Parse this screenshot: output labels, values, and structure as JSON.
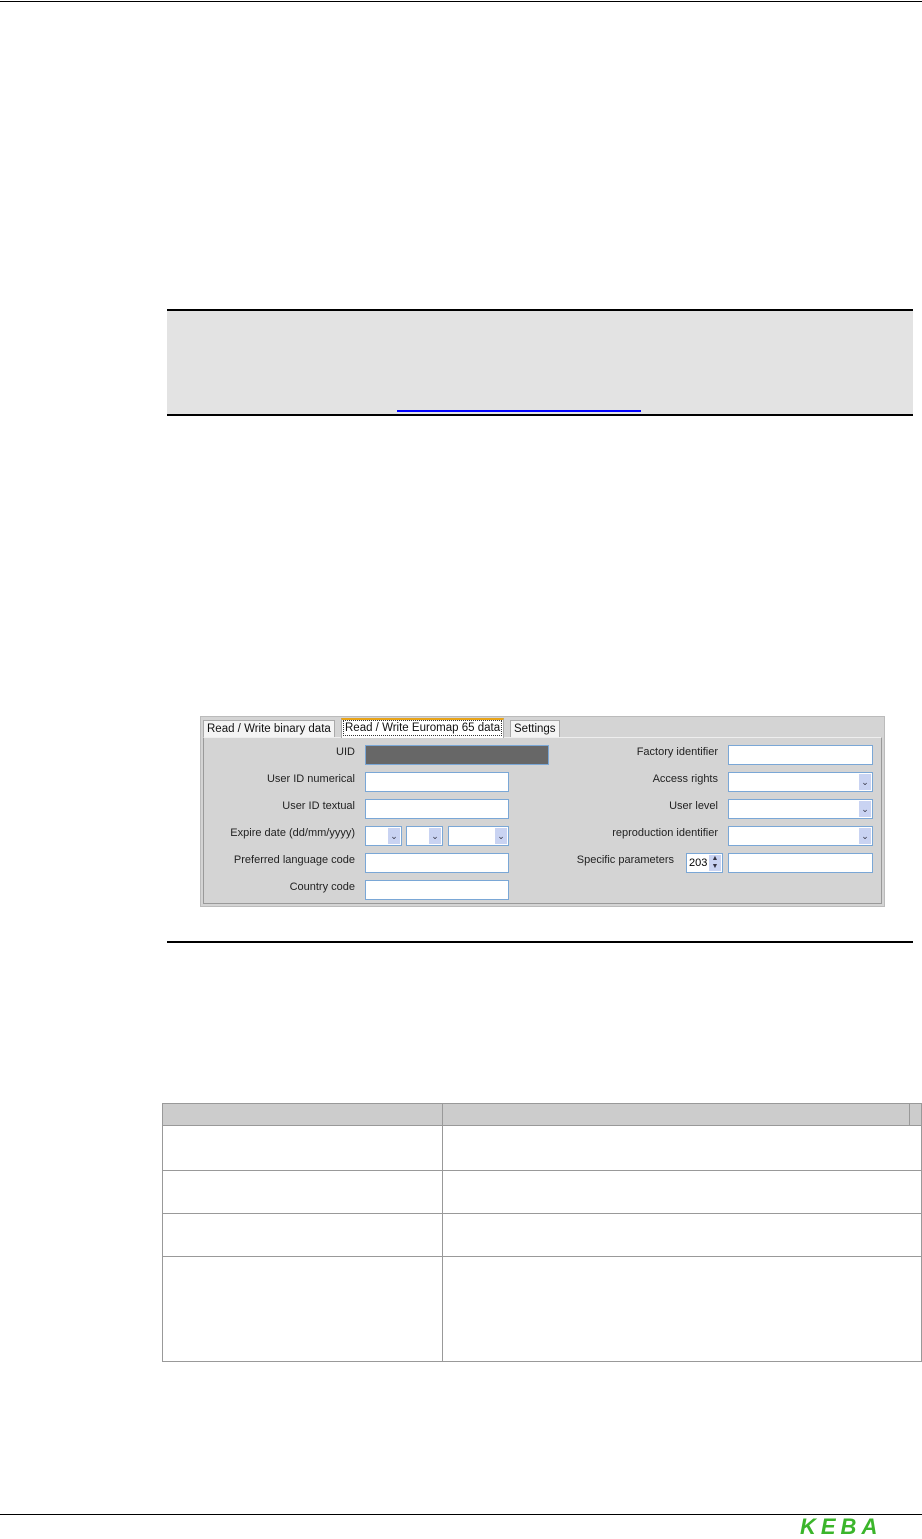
{
  "dialog": {
    "tabs": [
      "Read / Write binary  data",
      "Read / Write Euromap 65 data",
      "Settings"
    ],
    "active_tab": 1,
    "left_fields": {
      "uid": "UID",
      "user_id_numerical": "User ID numerical",
      "user_id_textual": "User ID textual",
      "expire_date": "Expire date (dd/mm/yyyy)",
      "preferred_language": "Preferred language code",
      "country_code": "Country code"
    },
    "right_fields": {
      "factory_identifier": "Factory identifier",
      "access_rights": "Access rights",
      "user_level": "User level",
      "reproduction_identifier": "reproduction identifier",
      "specific_parameters": "Specific parameters",
      "specific_parameters_value": "203"
    }
  },
  "footer": {
    "logo": "KEBA",
    "logo_color": "#3bb52b"
  },
  "note": {
    "background": "#e3e3e3",
    "link_color": "#0000ff"
  }
}
